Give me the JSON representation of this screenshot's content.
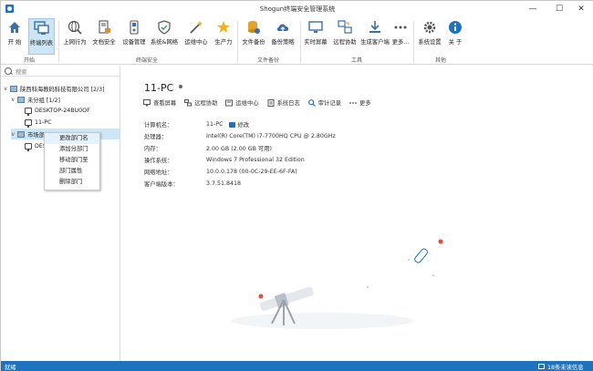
{
  "window": {
    "title": "Shogun终端安全管理系统"
  },
  "ribbon": {
    "groups": {
      "start": "开始",
      "security": "终端安全",
      "files": "文件备份",
      "tools": "工具",
      "others": "其他"
    },
    "buttons": [
      "开 始",
      "终端列表",
      "上网行为",
      "文档安全",
      "设备管理",
      "系统&网络",
      "运维中心",
      "生产力",
      "文件备份",
      "备份策略",
      "实时屏幕",
      "远程协助",
      "生成客户端",
      "更多...",
      "系统设置",
      "关 于"
    ]
  },
  "search": {
    "placeholder": "搜索"
  },
  "tree": {
    "company": "陕西科海教码科技有限公司 [2/3]",
    "ungrouped": "未分组 [1/2]",
    "pc1": "DESKTOP-24BU0OF",
    "pc2": "11-PC",
    "market": "市场部",
    "pc3": "DES"
  },
  "context_menu": [
    "更改部门名",
    "添加分部门",
    "移动部门至",
    "部门属性",
    "删除部门"
  ],
  "detail": {
    "name": "11-PC",
    "actions": [
      "查看屏幕",
      "远程协助",
      "运维中心",
      "系统日志",
      "审计记录",
      "更多"
    ],
    "edit": "修改",
    "rows": [
      {
        "k": "计算机名：",
        "v": "11-PC"
      },
      {
        "k": "处理器：",
        "v": "Intel(R) Core(TM) i7-7700HQ CPU @ 2.80GHz"
      },
      {
        "k": "内存：",
        "v": "2.00 GB (2.00 GB 可用)"
      },
      {
        "k": "操作系统：",
        "v": "Windows 7 Professional 32 Edition"
      },
      {
        "k": "网络地址：",
        "v": "10.0.0.178  (00-0C-29-EE-6F-FA)"
      },
      {
        "k": "客户端版本：",
        "v": "3.7.51.8418"
      }
    ]
  },
  "status": {
    "left": "就绪",
    "right": "18条未读信息"
  },
  "colors": {
    "accent": "#1e73be",
    "selection": "#cde6f7"
  }
}
